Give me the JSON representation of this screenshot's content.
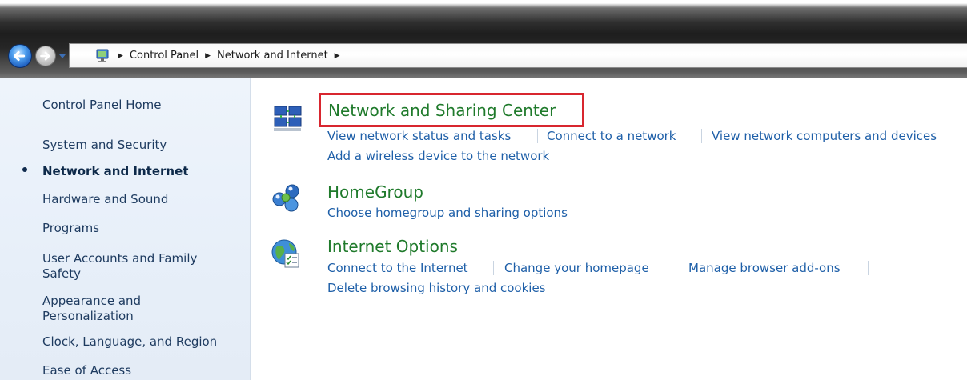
{
  "address": {
    "crumbs": [
      "Control Panel",
      "Network and Internet"
    ]
  },
  "icons": {
    "back": "back-arrow-icon",
    "forward": "forward-arrow-icon",
    "recent": "dropdown-arrow-icon",
    "location": "control-panel-icon",
    "network": "network-and-sharing-icon",
    "homegroup": "homegroup-icon",
    "internet": "internet-options-icon"
  },
  "sidebar": {
    "items": [
      {
        "label": "Control Panel Home"
      },
      {
        "label": "System and Security"
      },
      {
        "label": "Network and Internet",
        "current": true
      },
      {
        "label": "Hardware and Sound"
      },
      {
        "label": "Programs"
      },
      {
        "label": "User Accounts and Family Safety"
      },
      {
        "label": "Appearance and Personalization"
      },
      {
        "label": "Clock, Language, and Region"
      },
      {
        "label": "Ease of Access"
      }
    ]
  },
  "categories": [
    {
      "title": "Network and Sharing Center",
      "highlighted": true,
      "links": [
        "View network status and tasks",
        "Connect to a network",
        "View network computers and devices",
        "Add a wireless device to the network"
      ]
    },
    {
      "title": "HomeGroup",
      "links": [
        "Choose homegroup and sharing options"
      ]
    },
    {
      "title": "Internet Options",
      "links": [
        "Connect to the Internet",
        "Change your homepage",
        "Manage browser add-ons",
        "Delete browsing history and cookies"
      ]
    }
  ],
  "colors": {
    "category_title": "#1f7a2b",
    "link": "#1e5fa8",
    "highlight_box": "#d8262f",
    "sidebar_bg": "#e7eff9"
  }
}
